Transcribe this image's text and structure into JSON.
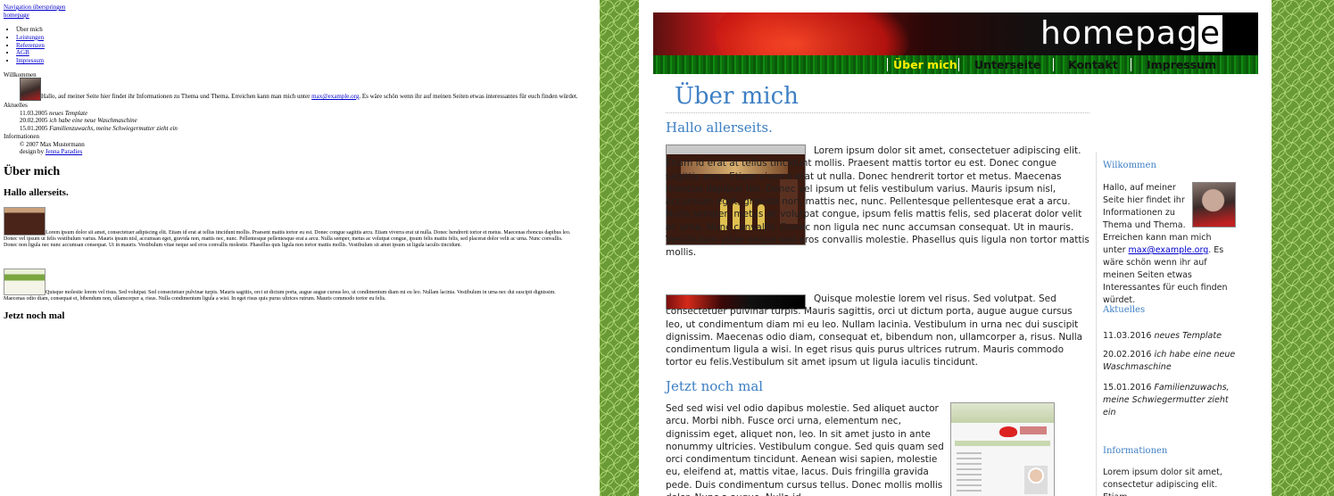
{
  "left": {
    "skip_link": "Navigation überspringen",
    "home_link": "homepage",
    "nav_items": [
      "Über mich",
      "Leistungen",
      "Referenzen",
      "AGB",
      "Impressum"
    ],
    "willkommen_label": "Willkommen",
    "willkommen_text_before": "Hallo, auf meiner Seite hier findet ihr Informationen zu Thema und Thema. Erreichen kann man mich unter ",
    "willkommen_email": "max@example.org",
    "willkommen_text_after": ". Es wäre schön wenn ihr auf meinen Seiten etwas interessantes für euch finden würdet.",
    "aktuelles_label": "Aktuelles",
    "news": [
      {
        "date": "11.03.2005",
        "text": "neues Template"
      },
      {
        "date": "20.02.2005",
        "text": "ich habe eine neue Waschmaschine"
      },
      {
        "date": "15.01.2005",
        "text": "Familienzuwachs, meine Schwiegermutter zieht ein"
      }
    ],
    "informationen_label": "Informationen",
    "copyright": "© 2007 Max Mustermann",
    "design_by": "design by ",
    "design_link": "Jenna Paradies",
    "h1": "Über mich",
    "h2": "Hallo allerseits.",
    "para1": "Lorem ipsum dolor sit amet, consectetuer adipiscing elit. Etiam id erat at tellus tincidunt mollis. Praesent mattis tortor eu est. Donec congue sagittis arcu. Etiam viverra erat ut nulla. Donec hendrerit tortor et metus. Maecenas rhoncus dapibus leo. Donec vel ipsum ut felis vestibulum varius. Mauris ipsum nisl, accumsan eget, gravida non, mattis nec, nunc. Pellentesque pellentesque erat a arcu. Nulla semper, metus ac volutpat congue, ipsum felis mattis felis, sed placerat dolor velit ac urna. Nunc convallis. Donec non ligula nec nunc accumsan consequat. Ut in mauris. Vestibulum vitae neque sed eros convallis molestie. Phasellus quis ligula non tortor mattis mollis. Vestibulum sit amet ipsum ut ligula iaculis tincidunt.",
    "para2": "Quisque molestie lorem vel risus. Sed volutpat. Sed consectetuer pulvinar turpis. Mauris sagittis, orci ut dictum porta, augue augue cursus leo, ut condimentum diam mi eu leo. Nullam lacinia. Vestibulum in urna nec dui suscipit dignissim. Maecenas odio diam, consequat et, bibendum non, ullamcorper a, risus. Nulla condimentum ligula a wisi. In eget risus quis purus ultrices rutrum. Mauris commodo tortor eu felis.",
    "h2b": "Jetzt noch mal"
  },
  "right": {
    "banner_title_main": "homepag",
    "banner_title_last": "e",
    "nav": [
      "Über mich",
      "Unterseite",
      "Kontakt",
      "Impressum"
    ],
    "page_title": "Über mich",
    "section1_title": "Hallo allerseits.",
    "section1_p1": "Lorem ipsum dolor sit amet, consectetuer adipiscing elit. Etiam id erat at tellus tincidunt mollis. Praesent mattis tortor eu est. Donec congue sagittis arcu. Etiam viverra erat ut nulla. Donec hendrerit tortor et metus. Maecenas rhoncus dapibus leo. Donec vel ipsum ut felis vestibulum varius. Mauris ipsum nisl, accumsan eget, gravida non, mattis nec, nunc. Pellentesque pellentesque erat a arcu. Nulla semper, metus ac volutpat congue, ipsum felis mattis felis, sed placerat dolor velit ac urna. Nunc convallis. Donec non ligula nec nunc accumsan consequat. Ut in mauris. Vestibulum vitae neque sed eros convallis molestie. Phasellus quis ligula non tortor mattis mollis.",
    "section1_p2": "Quisque molestie lorem vel risus. Sed volutpat. Sed consectetuer pulvinar turpis. Mauris sagittis, orci ut dictum porta, augue augue cursus leo, ut condimentum diam mi eu leo. Nullam lacinia. Vestibulum in urna nec dui suscipit dignissim. Maecenas odio diam, consequat et, bibendum non, ullamcorper a, risus. Nulla condimentum ligula a wisi. In eget risus quis purus ultrices rutrum. Mauris commodo tortor eu felis.Vestibulum sit amet ipsum ut ligula iaculis tincidunt.",
    "section2_title": "Jetzt noch mal",
    "section2_p1": "Sed sed wisi vel odio dapibus molestie. Sed aliquet auctor arcu. Morbi nibh. Fusce orci urna, elementum nec, dignissim eget, aliquet non, leo. In sit amet justo in ante nonummy ultricies. Vestibulum congue. Sed quis quam sed orci condimentum tincidunt. Aenean wisi sapien, molestie eu, eleifend at, mattis vitae, lacus. Duis fringilla gravida pede. Duis condimentum cursus tellus. Donec mollis mollis dolor. Nunc a augue. Nulla id",
    "sidebar": {
      "willkommen_title": "Wilkommen",
      "willkommen_text_before": "Hallo, auf meiner Seite hier findet ihr Informationen zu Thema und Thema. Erreichen kann man mich unter ",
      "willkommen_email": "max@example.org",
      "willkommen_text_after": ". Es wäre schön wenn ihr auf meinen Seiten etwas Interessantes für euch finden würdet.",
      "aktuelles_title": "Aktuelles",
      "news": [
        {
          "date": "11.03.2016",
          "text": "neues Template"
        },
        {
          "date": "20.02.2016",
          "text": "ich habe eine neue Waschmaschine"
        },
        {
          "date": "15.01.2016",
          "text": "Familienzuwachs, meine Schwiegermutter zieht ein"
        }
      ],
      "informationen_title": "Informationen",
      "informationen_text": "Lorem ipsum dolor sit amet, consectetur adipiscing elit. Etiam"
    }
  }
}
